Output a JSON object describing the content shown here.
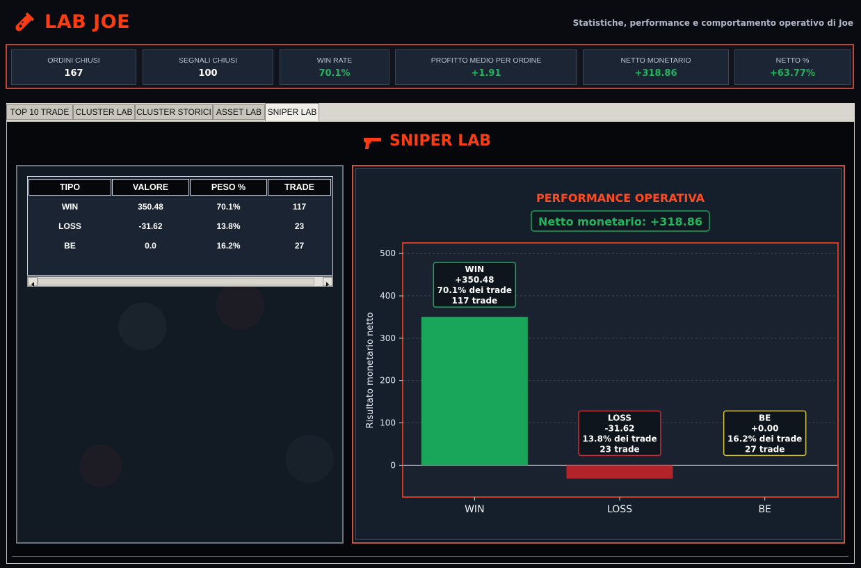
{
  "app": {
    "title": "LAB JOE",
    "subtitle": "Statistiche, performance e comportamento operativo di Joe",
    "logo_icon": "test-tube-icon"
  },
  "stats": [
    {
      "label": "ORDINI CHIUSI",
      "value": "167",
      "color": "#ffffff"
    },
    {
      "label": "SEGNALI CHIUSI",
      "value": "100",
      "color": "#ffffff"
    },
    {
      "label": "WIN RATE",
      "value": "70.1%",
      "color": "#22b35e"
    },
    {
      "label": "PROFITTO MEDIO PER ORDINE",
      "value": "+1.91",
      "color": "#22b35e"
    },
    {
      "label": "NETTO MONETARIO",
      "value": "+318.86",
      "color": "#22b35e"
    },
    {
      "label": "NETTO %",
      "value": "+63.77%",
      "color": "#22b35e"
    }
  ],
  "tabs": [
    {
      "label": "TOP 10 TRADE"
    },
    {
      "label": "CLUSTER LAB"
    },
    {
      "label": "CLUSTER STORICI"
    },
    {
      "label": "ASSET LAB"
    },
    {
      "label": "SNIPER LAB",
      "active": true
    }
  ],
  "section": {
    "title": "SNIPER LAB",
    "icon": "gun-icon"
  },
  "table": {
    "columns": [
      "TIPO",
      "VALORE",
      "PESO %",
      "TRADE"
    ],
    "rows": [
      [
        "WIN",
        "350.48",
        "70.1%",
        "117"
      ],
      [
        "LOSS",
        "-31.62",
        "13.8%",
        "23"
      ],
      [
        "BE",
        "0.0",
        "16.2%",
        "27"
      ]
    ]
  },
  "chart_data": {
    "type": "bar",
    "title": "PERFORMANCE OPERATIVA",
    "subtitle": "Netto monetario: +318.86",
    "ylabel": "Risultato monetario netto",
    "xlabel": "",
    "ylim": [
      -75,
      525
    ],
    "yticks": [
      0,
      100,
      200,
      300,
      400,
      500
    ],
    "grid": true,
    "categories": [
      "WIN",
      "LOSS",
      "BE"
    ],
    "values": [
      350.48,
      -31.62,
      0.0
    ],
    "colors": [
      "#1aa65a",
      "#b2232a",
      "#c9b93a"
    ],
    "annotations": [
      [
        "WIN",
        "+350.48",
        "70.1% dei trade",
        "117 trade"
      ],
      [
        "LOSS",
        "-31.62",
        "13.8% dei trade",
        "23 trade"
      ],
      [
        "BE",
        "+0.00",
        "16.2% dei trade",
        "27 trade"
      ]
    ],
    "annotation_colors": [
      "#1aa65a",
      "#c4323a",
      "#d4c446"
    ]
  }
}
